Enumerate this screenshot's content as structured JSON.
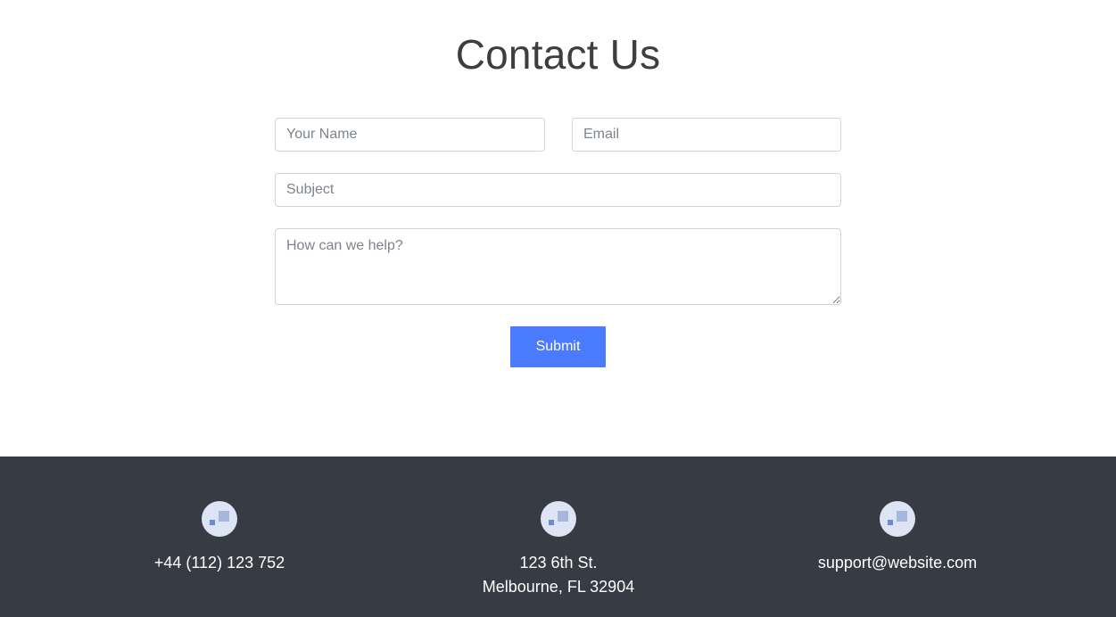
{
  "contact": {
    "title": "Contact Us",
    "form": {
      "name_placeholder": "Your Name",
      "email_placeholder": "Email",
      "subject_placeholder": "Subject",
      "message_placeholder": "How can we help?",
      "submit_label": "Submit"
    }
  },
  "footer": {
    "phone": {
      "icon": "phone-icon",
      "text": "+44 (112) 123 752"
    },
    "address": {
      "icon": "location-icon",
      "line1": "123 6th St.",
      "line2": "Melbourne, FL 32904"
    },
    "email": {
      "icon": "email-icon",
      "text": "support@website.com"
    }
  },
  "colors": {
    "primary": "#4a7bff",
    "footer_bg": "#373b43",
    "title": "#3e3e3e",
    "icon_circle": "#dde4f3"
  }
}
